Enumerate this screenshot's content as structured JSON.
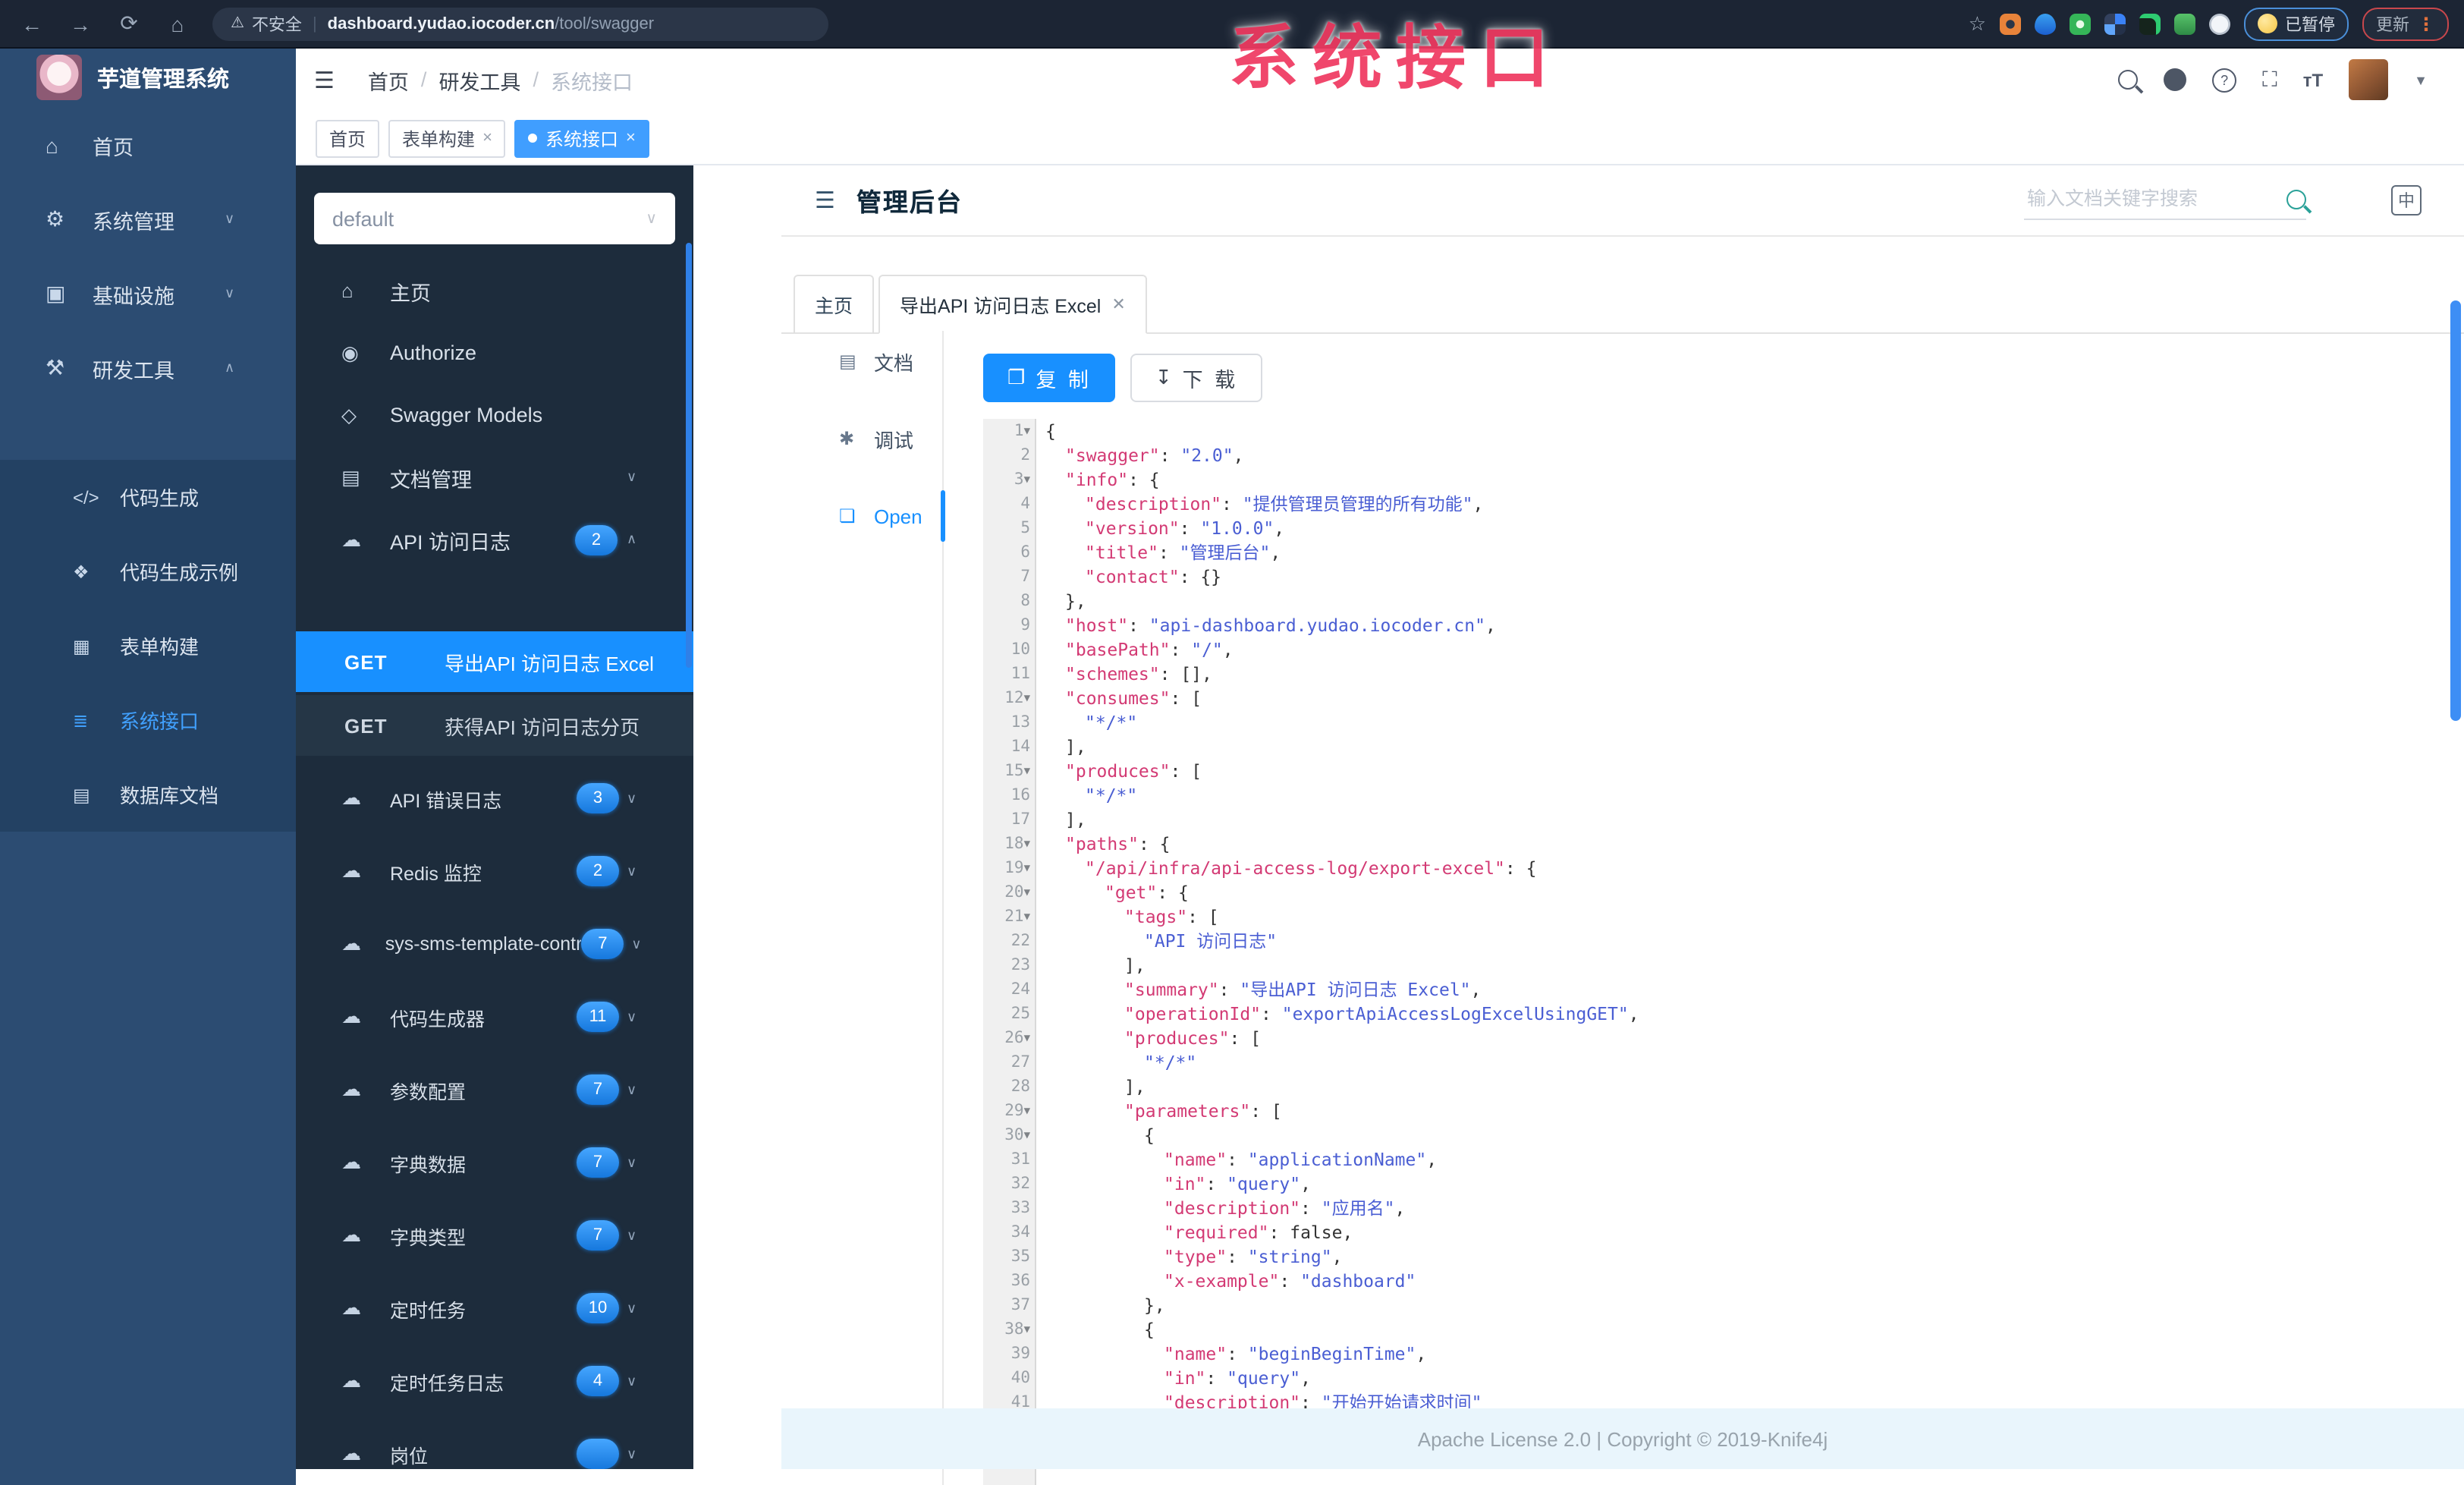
{
  "colors": {
    "accent": "#1890ff",
    "tag_active": "#409eff",
    "sidebar_bg": "#2c4c72",
    "api_sidebar_bg": "#1d2c3c",
    "footer_bg": "#e9f5fc",
    "watermark": "#ef3a61",
    "code_key": "#d33a74",
    "code_string": "#4a5ed3"
  },
  "browser": {
    "security": "不安全",
    "url_host": "dashboard.yudao.iocoder.cn",
    "url_path": "/tool/swagger",
    "paused": "已暂停",
    "update": "更新"
  },
  "watermark": "系统接口",
  "header": {
    "logo_title": "芋道管理系统",
    "breadcrumb": [
      "首页",
      "研发工具",
      "系统接口"
    ],
    "tags": [
      {
        "label": "首页",
        "closable": false,
        "active": false
      },
      {
        "label": "表单构建",
        "closable": true,
        "active": false
      },
      {
        "label": "系统接口",
        "closable": true,
        "active": true
      }
    ]
  },
  "sidebar": {
    "items": [
      {
        "label": "首页",
        "icon": "home-icon"
      },
      {
        "label": "系统管理",
        "icon": "gear-icon",
        "chevron": "down"
      },
      {
        "label": "基础设施",
        "icon": "infra-icon",
        "chevron": "down"
      },
      {
        "label": "研发工具",
        "icon": "tools-icon",
        "chevron": "up",
        "expanded": true
      }
    ],
    "sub_items": [
      {
        "label": "代码生成",
        "icon": "code-icon"
      },
      {
        "label": "代码生成示例",
        "icon": "shield-icon"
      },
      {
        "label": "表单构建",
        "icon": "form-icon"
      },
      {
        "label": "系统接口",
        "icon": "api-icon",
        "active": true
      },
      {
        "label": "数据库文档",
        "icon": "database-icon"
      }
    ]
  },
  "api_sidebar": {
    "select_value": "default",
    "items": [
      {
        "label": "主页",
        "icon": "home-icon"
      },
      {
        "label": "Authorize",
        "icon": "auth-icon"
      },
      {
        "label": "Swagger Models",
        "icon": "models-icon"
      },
      {
        "label": "文档管理",
        "icon": "docs-icon",
        "chevron": "down"
      },
      {
        "label": "API 访问日志",
        "icon": "cloud-icon",
        "badge": "2",
        "chevron": "up",
        "expanded": true
      }
    ],
    "operations": [
      {
        "method": "GET",
        "label": "导出API 访问日志 Excel",
        "active": true
      },
      {
        "method": "GET",
        "label": "获得API 访问日志分页",
        "active": false
      }
    ],
    "groups": [
      {
        "label": "API 错误日志",
        "icon": "cloud-icon",
        "badge": "3"
      },
      {
        "label": "Redis 监控",
        "icon": "cloud-icon",
        "badge": "2"
      },
      {
        "label": "sys-sms-template-controller",
        "icon": "cloud-icon",
        "badge": "7"
      },
      {
        "label": "代码生成器",
        "icon": "cloud-icon",
        "badge": "11"
      },
      {
        "label": "参数配置",
        "icon": "cloud-icon",
        "badge": "7"
      },
      {
        "label": "字典数据",
        "icon": "cloud-icon",
        "badge": "7"
      },
      {
        "label": "字典类型",
        "icon": "cloud-icon",
        "badge": "7"
      },
      {
        "label": "定时任务",
        "icon": "cloud-icon",
        "badge": "10"
      },
      {
        "label": "定时任务日志",
        "icon": "cloud-icon",
        "badge": "4"
      },
      {
        "label": "岗位",
        "icon": "cloud-icon",
        "badge": ""
      }
    ]
  },
  "doc": {
    "title": "管理后台",
    "search_placeholder": "输入文档关键字搜索",
    "lang_icon": "中",
    "tabs": [
      {
        "label": "主页",
        "closable": false,
        "active": false
      },
      {
        "label": "导出API 访问日志 Excel",
        "closable": true,
        "active": true
      }
    ],
    "rail": [
      {
        "label": "文档",
        "icon": "doc-icon",
        "active": false
      },
      {
        "label": "调试",
        "icon": "debug-icon",
        "active": false
      },
      {
        "label": "Open",
        "icon": "open-icon",
        "active": true
      }
    ],
    "copy_button": "复 制",
    "download_button": "下 载",
    "footer": "Apache License 2.0 | Copyright © 2019-Knife4j"
  },
  "code": {
    "lines": [
      {
        "n": 1,
        "f": 1,
        "i": 0,
        "t": [
          [
            "p",
            "{"
          ]
        ]
      },
      {
        "n": 2,
        "i": 1,
        "t": [
          [
            "k",
            "\"swagger\""
          ],
          [
            "p",
            ": "
          ],
          [
            "s",
            "\"2.0\""
          ],
          [
            "p",
            ","
          ]
        ]
      },
      {
        "n": 3,
        "f": 1,
        "i": 1,
        "t": [
          [
            "k",
            "\"info\""
          ],
          [
            "p",
            ": {"
          ]
        ]
      },
      {
        "n": 4,
        "i": 2,
        "t": [
          [
            "k",
            "\"description\""
          ],
          [
            "p",
            ": "
          ],
          [
            "s",
            "\"提供管理员管理的所有功能\""
          ],
          [
            "p",
            ","
          ]
        ]
      },
      {
        "n": 5,
        "i": 2,
        "t": [
          [
            "k",
            "\"version\""
          ],
          [
            "p",
            ": "
          ],
          [
            "s",
            "\"1.0.0\""
          ],
          [
            "p",
            ","
          ]
        ]
      },
      {
        "n": 6,
        "i": 2,
        "t": [
          [
            "k",
            "\"title\""
          ],
          [
            "p",
            ": "
          ],
          [
            "s",
            "\"管理后台\""
          ],
          [
            "p",
            ","
          ]
        ]
      },
      {
        "n": 7,
        "i": 2,
        "t": [
          [
            "k",
            "\"contact\""
          ],
          [
            "p",
            ": {}"
          ]
        ]
      },
      {
        "n": 8,
        "i": 1,
        "t": [
          [
            "p",
            "},"
          ]
        ]
      },
      {
        "n": 9,
        "i": 1,
        "t": [
          [
            "k",
            "\"host\""
          ],
          [
            "p",
            ": "
          ],
          [
            "s",
            "\"api-dashboard.yudao.iocoder.cn\""
          ],
          [
            "p",
            ","
          ]
        ]
      },
      {
        "n": 10,
        "i": 1,
        "t": [
          [
            "k",
            "\"basePath\""
          ],
          [
            "p",
            ": "
          ],
          [
            "s",
            "\"/\""
          ],
          [
            "p",
            ","
          ]
        ]
      },
      {
        "n": 11,
        "i": 1,
        "t": [
          [
            "k",
            "\"schemes\""
          ],
          [
            "p",
            ": [],"
          ]
        ]
      },
      {
        "n": 12,
        "f": 1,
        "i": 1,
        "t": [
          [
            "k",
            "\"consumes\""
          ],
          [
            "p",
            ": ["
          ]
        ]
      },
      {
        "n": 13,
        "i": 2,
        "t": [
          [
            "s",
            "\"*/*\""
          ]
        ]
      },
      {
        "n": 14,
        "i": 1,
        "t": [
          [
            "p",
            "],"
          ]
        ]
      },
      {
        "n": 15,
        "f": 1,
        "i": 1,
        "t": [
          [
            "k",
            "\"produces\""
          ],
          [
            "p",
            ": ["
          ]
        ]
      },
      {
        "n": 16,
        "i": 2,
        "t": [
          [
            "s",
            "\"*/*\""
          ]
        ]
      },
      {
        "n": 17,
        "i": 1,
        "t": [
          [
            "p",
            "],"
          ]
        ]
      },
      {
        "n": 18,
        "f": 1,
        "i": 1,
        "t": [
          [
            "k",
            "\"paths\""
          ],
          [
            "p",
            ": {"
          ]
        ]
      },
      {
        "n": 19,
        "f": 1,
        "i": 2,
        "t": [
          [
            "k",
            "\"/api/infra/api-access-log/export-excel\""
          ],
          [
            "p",
            ": {"
          ]
        ]
      },
      {
        "n": 20,
        "f": 1,
        "i": 3,
        "t": [
          [
            "k",
            "\"get\""
          ],
          [
            "p",
            ": {"
          ]
        ]
      },
      {
        "n": 21,
        "f": 1,
        "i": 4,
        "t": [
          [
            "k",
            "\"tags\""
          ],
          [
            "p",
            ": ["
          ]
        ]
      },
      {
        "n": 22,
        "i": 5,
        "t": [
          [
            "s",
            "\"API 访问日志\""
          ]
        ]
      },
      {
        "n": 23,
        "i": 4,
        "t": [
          [
            "p",
            "],"
          ]
        ]
      },
      {
        "n": 24,
        "i": 4,
        "t": [
          [
            "k",
            "\"summary\""
          ],
          [
            "p",
            ": "
          ],
          [
            "s",
            "\"导出API 访问日志 Excel\""
          ],
          [
            "p",
            ","
          ]
        ]
      },
      {
        "n": 25,
        "i": 4,
        "t": [
          [
            "k",
            "\"operationId\""
          ],
          [
            "p",
            ": "
          ],
          [
            "s",
            "\"exportApiAccessLogExcelUsingGET\""
          ],
          [
            "p",
            ","
          ]
        ]
      },
      {
        "n": 26,
        "f": 1,
        "i": 4,
        "t": [
          [
            "k",
            "\"produces\""
          ],
          [
            "p",
            ": ["
          ]
        ]
      },
      {
        "n": 27,
        "i": 5,
        "t": [
          [
            "s",
            "\"*/*\""
          ]
        ]
      },
      {
        "n": 28,
        "i": 4,
        "t": [
          [
            "p",
            "],"
          ]
        ]
      },
      {
        "n": 29,
        "f": 1,
        "i": 4,
        "t": [
          [
            "k",
            "\"parameters\""
          ],
          [
            "p",
            ": ["
          ]
        ]
      },
      {
        "n": 30,
        "f": 1,
        "i": 5,
        "t": [
          [
            "p",
            "{"
          ]
        ]
      },
      {
        "n": 31,
        "i": 6,
        "t": [
          [
            "k",
            "\"name\""
          ],
          [
            "p",
            ": "
          ],
          [
            "s",
            "\"applicationName\""
          ],
          [
            "p",
            ","
          ]
        ]
      },
      {
        "n": 32,
        "i": 6,
        "t": [
          [
            "k",
            "\"in\""
          ],
          [
            "p",
            ": "
          ],
          [
            "s",
            "\"query\""
          ],
          [
            "p",
            ","
          ]
        ]
      },
      {
        "n": 33,
        "i": 6,
        "t": [
          [
            "k",
            "\"description\""
          ],
          [
            "p",
            ": "
          ],
          [
            "s",
            "\"应用名\""
          ],
          [
            "p",
            ","
          ]
        ]
      },
      {
        "n": 34,
        "i": 6,
        "t": [
          [
            "k",
            "\"required\""
          ],
          [
            "p",
            ": "
          ],
          [
            "b",
            "false"
          ],
          [
            "p",
            ","
          ]
        ]
      },
      {
        "n": 35,
        "i": 6,
        "t": [
          [
            "k",
            "\"type\""
          ],
          [
            "p",
            ": "
          ],
          [
            "s",
            "\"string\""
          ],
          [
            "p",
            ","
          ]
        ]
      },
      {
        "n": 36,
        "i": 6,
        "t": [
          [
            "k",
            "\"x-example\""
          ],
          [
            "p",
            ": "
          ],
          [
            "s",
            "\"dashboard\""
          ]
        ]
      },
      {
        "n": 37,
        "i": 5,
        "t": [
          [
            "p",
            "},"
          ]
        ]
      },
      {
        "n": 38,
        "f": 1,
        "i": 5,
        "t": [
          [
            "p",
            "{"
          ]
        ]
      },
      {
        "n": 39,
        "i": 6,
        "t": [
          [
            "k",
            "\"name\""
          ],
          [
            "p",
            ": "
          ],
          [
            "s",
            "\"beginBeginTime\""
          ],
          [
            "p",
            ","
          ]
        ]
      },
      {
        "n": 40,
        "i": 6,
        "t": [
          [
            "k",
            "\"in\""
          ],
          [
            "p",
            ": "
          ],
          [
            "s",
            "\"query\""
          ],
          [
            "p",
            ","
          ]
        ]
      },
      {
        "n": 41,
        "i": 6,
        "t": [
          [
            "k",
            "\"description\""
          ],
          [
            "p",
            ": "
          ],
          [
            "s",
            "\"开始开始请求时间\""
          ]
        ]
      }
    ]
  }
}
